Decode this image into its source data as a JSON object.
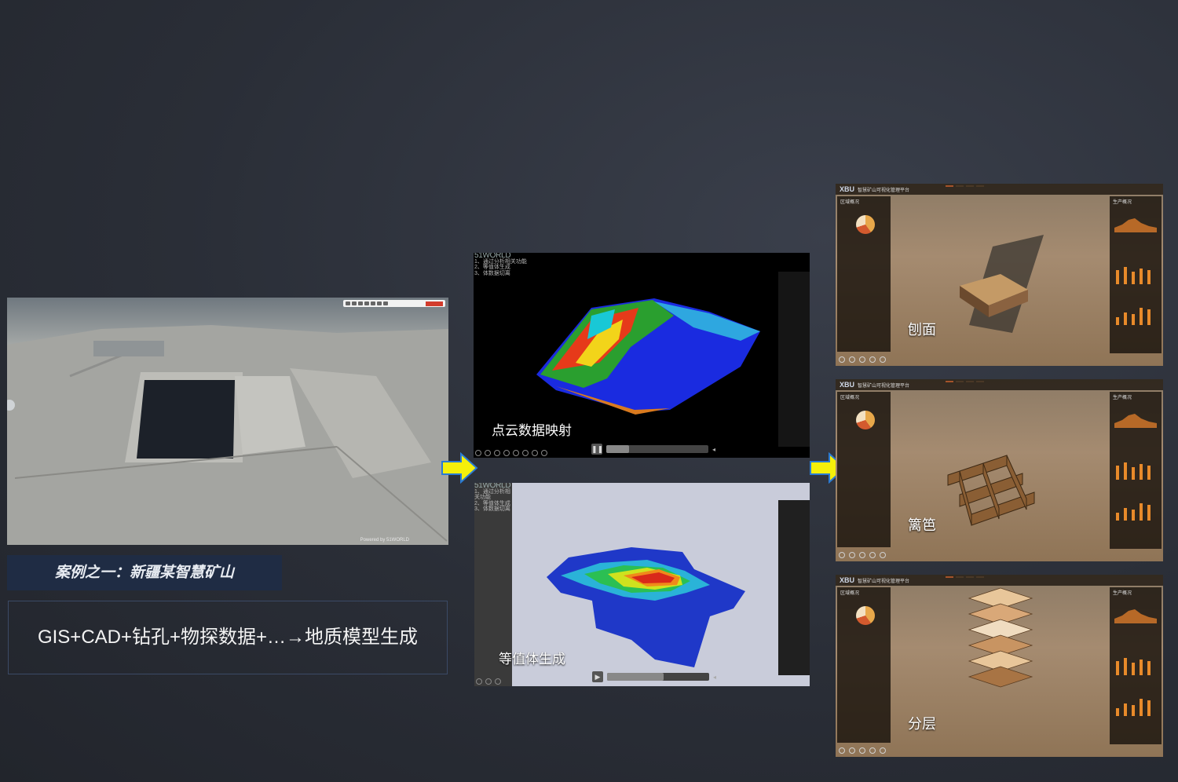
{
  "left": {
    "case_title": "案例之一：新疆某智慧矿山",
    "formula": "GIS+CAD+钻孔+物探数据+…→地质模型生成",
    "watermark": "Powered by 51WORLD"
  },
  "middle": {
    "top": {
      "logo": "51WORLD",
      "menu": [
        "1、通过分析相关功能",
        "2、等值体生成",
        "3、体数据切离"
      ],
      "caption": "点云数据映射",
      "progress": 0.22
    },
    "bottom": {
      "logo": "51WORLD",
      "menu": [
        "1、通过分析相关功能",
        "2、等值体生成",
        "3、体数据切离"
      ],
      "caption": "等值体生成",
      "progress": 0.55
    }
  },
  "right": {
    "brand": "XBU",
    "platform_title": "智慧矿山可视化管理平台",
    "left_panel_title": "区域概况",
    "right_panel_title": "生产概况",
    "views": [
      {
        "caption": "刨面"
      },
      {
        "caption": "篱笆"
      },
      {
        "caption": "分层"
      }
    ]
  },
  "colors": {
    "arrow": "#f5f00a",
    "arrow_outline": "#2a7bd4",
    "title_box": "#1f2c44",
    "accent_orange": "#e88a2a"
  }
}
